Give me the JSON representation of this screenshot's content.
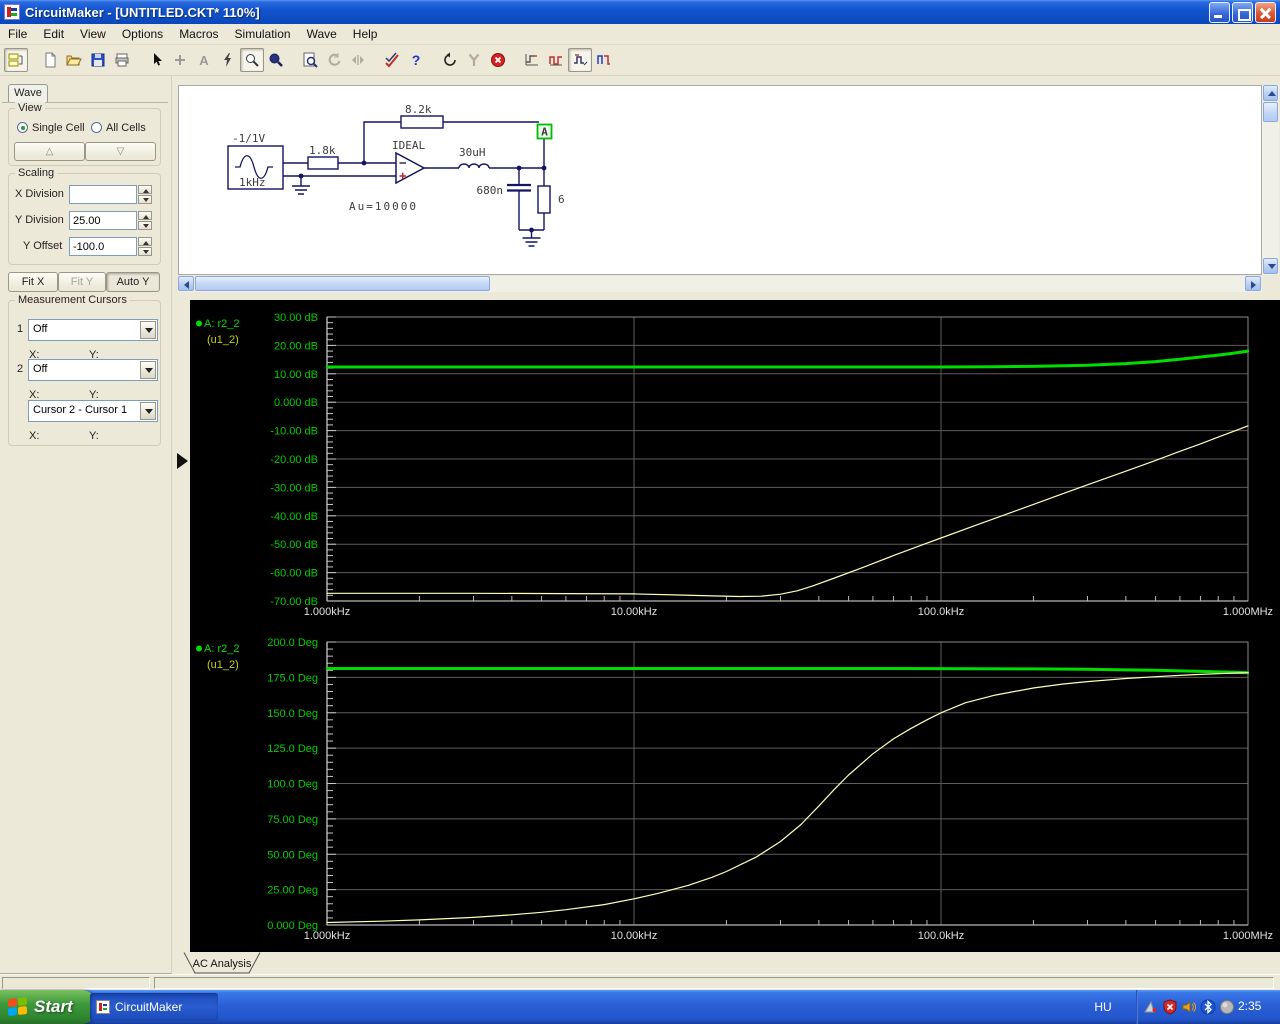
{
  "window": {
    "title": "CircuitMaker - [UNTITLED.CKT* 110%]"
  },
  "menu": {
    "items": [
      "File",
      "Edit",
      "View",
      "Options",
      "Macros",
      "Simulation",
      "Wave",
      "Help"
    ]
  },
  "toolbar": {
    "text_tool_glyph": "A",
    "help_glyph": "?",
    "icons": [
      "part-browser",
      "new-file",
      "open-file",
      "save-file",
      "print",
      "select-arrow",
      "place-part",
      "text-tool",
      "delete-tool",
      "zoom-window",
      "zoom-in",
      "print-preview",
      "rotate",
      "expand",
      "check-probe",
      "help",
      "reset",
      "setup-tools",
      "stop-simulation",
      "transient-setup",
      "digital-waveforms",
      "mixed-waveforms",
      "analog-waveforms"
    ]
  },
  "sidebar": {
    "tab_label": "Wave",
    "view": {
      "legend": "View",
      "single_cell": "Single Cell",
      "all_cells": "All Cells",
      "up_glyph": "△",
      "down_glyph": "▽"
    },
    "scaling": {
      "legend": "Scaling",
      "x_division_label": "X Division",
      "x_division_value": "",
      "y_division_label": "Y Division",
      "y_division_value": "25.00",
      "y_offset_label": "Y Offset",
      "y_offset_value": "-100.0",
      "fit_x": "Fit X",
      "fit_y": "Fit Y",
      "auto_y": "Auto Y"
    },
    "cursors": {
      "legend": "Measurement Cursors",
      "c1_index": "1",
      "c1_value": "Off",
      "c2_index": "2",
      "c2_value": "Off",
      "diff_value": "Cursor 2 - Cursor 1",
      "x_label": "X:",
      "y_label": "Y:"
    }
  },
  "schematic": {
    "labels": {
      "source_amplitude": "-1/1V",
      "source_freq": "1kHz",
      "r_in": "1.8k",
      "r_fb": "8.2k",
      "opamp_model": "IDEAL",
      "gain": "Au=10000",
      "inductor": "30uH",
      "capacitor": "680n",
      "r_out": "6",
      "probe": "A"
    }
  },
  "plots_tab": {
    "label": "AC Analysis"
  },
  "chart_data": [
    {
      "type": "line",
      "id": "ac-magnitude",
      "signal_label": {
        "line1": "A: r2_2",
        "line2": "(u1_2)",
        "color1": "#00dd00",
        "color2": "#c8d400"
      },
      "x_scale": "log",
      "x_range_hz": [
        1000,
        1000000
      ],
      "x_ticks": [
        {
          "label": "1.000kHz",
          "hz": 1000
        },
        {
          "label": "10.00kHz",
          "hz": 10000
        },
        {
          "label": "100.0kHz",
          "hz": 100000
        },
        {
          "label": "1.000MHz",
          "hz": 1000000
        }
      ],
      "y_range": [
        -70,
        30
      ],
      "y_ticks": [
        {
          "label": "30.00 dB",
          "v": 30
        },
        {
          "label": "20.00 dB",
          "v": 20
        },
        {
          "label": "10.00 dB",
          "v": 10
        },
        {
          "label": "0.000 dB",
          "v": 0
        },
        {
          "label": "-10.00 dB",
          "v": -10
        },
        {
          "label": "-20.00 dB",
          "v": -20
        },
        {
          "label": "-30.00 dB",
          "v": -30
        },
        {
          "label": "-40.00 dB",
          "v": -40
        },
        {
          "label": "-50.00 dB",
          "v": -50
        },
        {
          "label": "-60.00 dB",
          "v": -60
        },
        {
          "label": "-70.00 dB",
          "v": -70
        }
      ],
      "grid_x_hz": [
        10000,
        100000
      ],
      "series": [
        {
          "name": "output-magnitude",
          "color": "#00dd00",
          "width": 3,
          "points": [
            [
              1000,
              12.4
            ],
            [
              2000,
              12.4
            ],
            [
              5000,
              12.4
            ],
            [
              10000,
              12.4
            ],
            [
              20000,
              12.4
            ],
            [
              50000,
              12.4
            ],
            [
              100000,
              12.4
            ],
            [
              150000,
              12.5
            ],
            [
              200000,
              12.6
            ],
            [
              300000,
              13.0
            ],
            [
              400000,
              13.6
            ],
            [
              500000,
              14.3
            ],
            [
              600000,
              15.1
            ],
            [
              700000,
              15.9
            ],
            [
              800000,
              16.6
            ],
            [
              900000,
              17.3
            ],
            [
              1000000,
              18.0
            ]
          ]
        },
        {
          "name": "error-magnitude",
          "color": "#ffffb8",
          "width": 1.2,
          "points": [
            [
              1000,
              -67.3
            ],
            [
              3000,
              -67.3
            ],
            [
              6000,
              -67.4
            ],
            [
              10000,
              -67.5
            ],
            [
              14000,
              -67.9
            ],
            [
              18000,
              -68.2
            ],
            [
              22000,
              -68.4
            ],
            [
              26000,
              -68.3
            ],
            [
              30000,
              -67.6
            ],
            [
              34000,
              -66.4
            ],
            [
              38000,
              -64.8
            ],
            [
              45000,
              -61.9
            ],
            [
              55000,
              -58.4
            ],
            [
              70000,
              -54.0
            ],
            [
              85000,
              -50.6
            ],
            [
              100000,
              -47.8
            ],
            [
              130000,
              -43.3
            ],
            [
              160000,
              -39.8
            ],
            [
              200000,
              -36.0
            ],
            [
              250000,
              -32.2
            ],
            [
              300000,
              -29.1
            ],
            [
              400000,
              -24.3
            ],
            [
              500000,
              -20.5
            ],
            [
              600000,
              -17.3
            ],
            [
              700000,
              -14.7
            ],
            [
              800000,
              -12.3
            ],
            [
              900000,
              -10.2
            ],
            [
              1000000,
              -8.3
            ]
          ]
        }
      ]
    },
    {
      "type": "line",
      "id": "ac-phase",
      "signal_label": {
        "line1": "A: r2_2",
        "line2": "(u1_2)",
        "color1": "#00dd00",
        "color2": "#c8d400"
      },
      "x_scale": "log",
      "x_range_hz": [
        1000,
        1000000
      ],
      "x_ticks": [
        {
          "label": "1.000kHz",
          "hz": 1000
        },
        {
          "label": "10.00kHz",
          "hz": 10000
        },
        {
          "label": "100.0kHz",
          "hz": 100000
        },
        {
          "label": "1.000MHz",
          "hz": 1000000
        }
      ],
      "y_range": [
        0,
        200
      ],
      "y_ticks": [
        {
          "label": "200.0 Deg",
          "v": 200
        },
        {
          "label": "175.0 Deg",
          "v": 175
        },
        {
          "label": "150.0 Deg",
          "v": 150
        },
        {
          "label": "125.0 Deg",
          "v": 125
        },
        {
          "label": "100.0 Deg",
          "v": 100
        },
        {
          "label": "75.00 Deg",
          "v": 75
        },
        {
          "label": "50.00 Deg",
          "v": 50
        },
        {
          "label": "25.00 Deg",
          "v": 25
        },
        {
          "label": "0.000 Deg",
          "v": 0
        }
      ],
      "grid_x_hz": [
        10000,
        100000
      ],
      "series": [
        {
          "name": "output-phase",
          "color": "#00dd00",
          "width": 3,
          "points": [
            [
              1000,
              181.3
            ],
            [
              50000,
              181.3
            ],
            [
              100000,
              181.2
            ],
            [
              200000,
              181.0
            ],
            [
              300000,
              180.7
            ],
            [
              400000,
              180.3
            ],
            [
              500000,
              180.0
            ],
            [
              600000,
              179.6
            ],
            [
              700000,
              179.2
            ],
            [
              800000,
              178.9
            ],
            [
              900000,
              178.6
            ],
            [
              1000000,
              178.2
            ]
          ]
        },
        {
          "name": "error-phase",
          "color": "#ffffb8",
          "width": 1.2,
          "points": [
            [
              1000,
              1.8
            ],
            [
              1500,
              2.7
            ],
            [
              2000,
              3.6
            ],
            [
              3000,
              5.4
            ],
            [
              4000,
              7.2
            ],
            [
              5000,
              9.0
            ],
            [
              6000,
              10.8
            ],
            [
              8000,
              14.4
            ],
            [
              10000,
              18.5
            ],
            [
              12000,
              22.4
            ],
            [
              15000,
              28.0
            ],
            [
              18000,
              33.8
            ],
            [
              20000,
              37.8
            ],
            [
              25000,
              48.0
            ],
            [
              30000,
              59.0
            ],
            [
              35000,
              71.0
            ],
            [
              40000,
              84.0
            ],
            [
              45000,
              96.0
            ],
            [
              50000,
              106.0
            ],
            [
              60000,
              121.0
            ],
            [
              70000,
              131.5
            ],
            [
              80000,
              139.0
            ],
            [
              90000,
              145.0
            ],
            [
              100000,
              150.0
            ],
            [
              120000,
              157.0
            ],
            [
              150000,
              162.5
            ],
            [
              200000,
              167.5
            ],
            [
              250000,
              170.3
            ],
            [
              300000,
              172.0
            ],
            [
              400000,
              174.2
            ],
            [
              500000,
              175.5
            ],
            [
              600000,
              176.4
            ],
            [
              700000,
              177.1
            ],
            [
              800000,
              177.6
            ],
            [
              900000,
              178.0
            ],
            [
              1000000,
              178.4
            ]
          ]
        }
      ]
    }
  ],
  "taskbar": {
    "start_label": "Start",
    "task_label": "CircuitMaker",
    "language_indicator": "HU",
    "clock": "2:35",
    "tray_icons": [
      "pointing-device-icon",
      "security-alert-icon",
      "volume-icon",
      "bluetooth-icon",
      "audio-device-icon"
    ]
  }
}
